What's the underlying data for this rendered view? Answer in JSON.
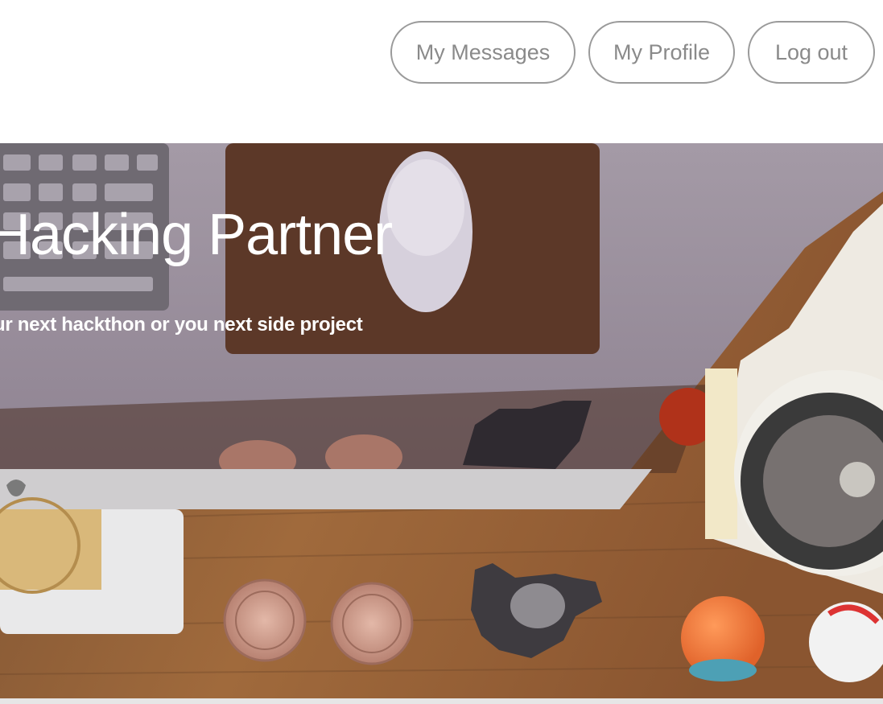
{
  "nav": {
    "messages_label": "My Messages",
    "profile_label": "My Profile",
    "logout_label": "Log out"
  },
  "hero": {
    "title": "Hacking Partner",
    "subtitle": "ur next hackthon or you next side project"
  },
  "colors": {
    "button_border": "#9a9a9a",
    "button_text": "#8a8a8a",
    "hero_text": "#ffffff",
    "desk_wood": "#8a5a34"
  }
}
